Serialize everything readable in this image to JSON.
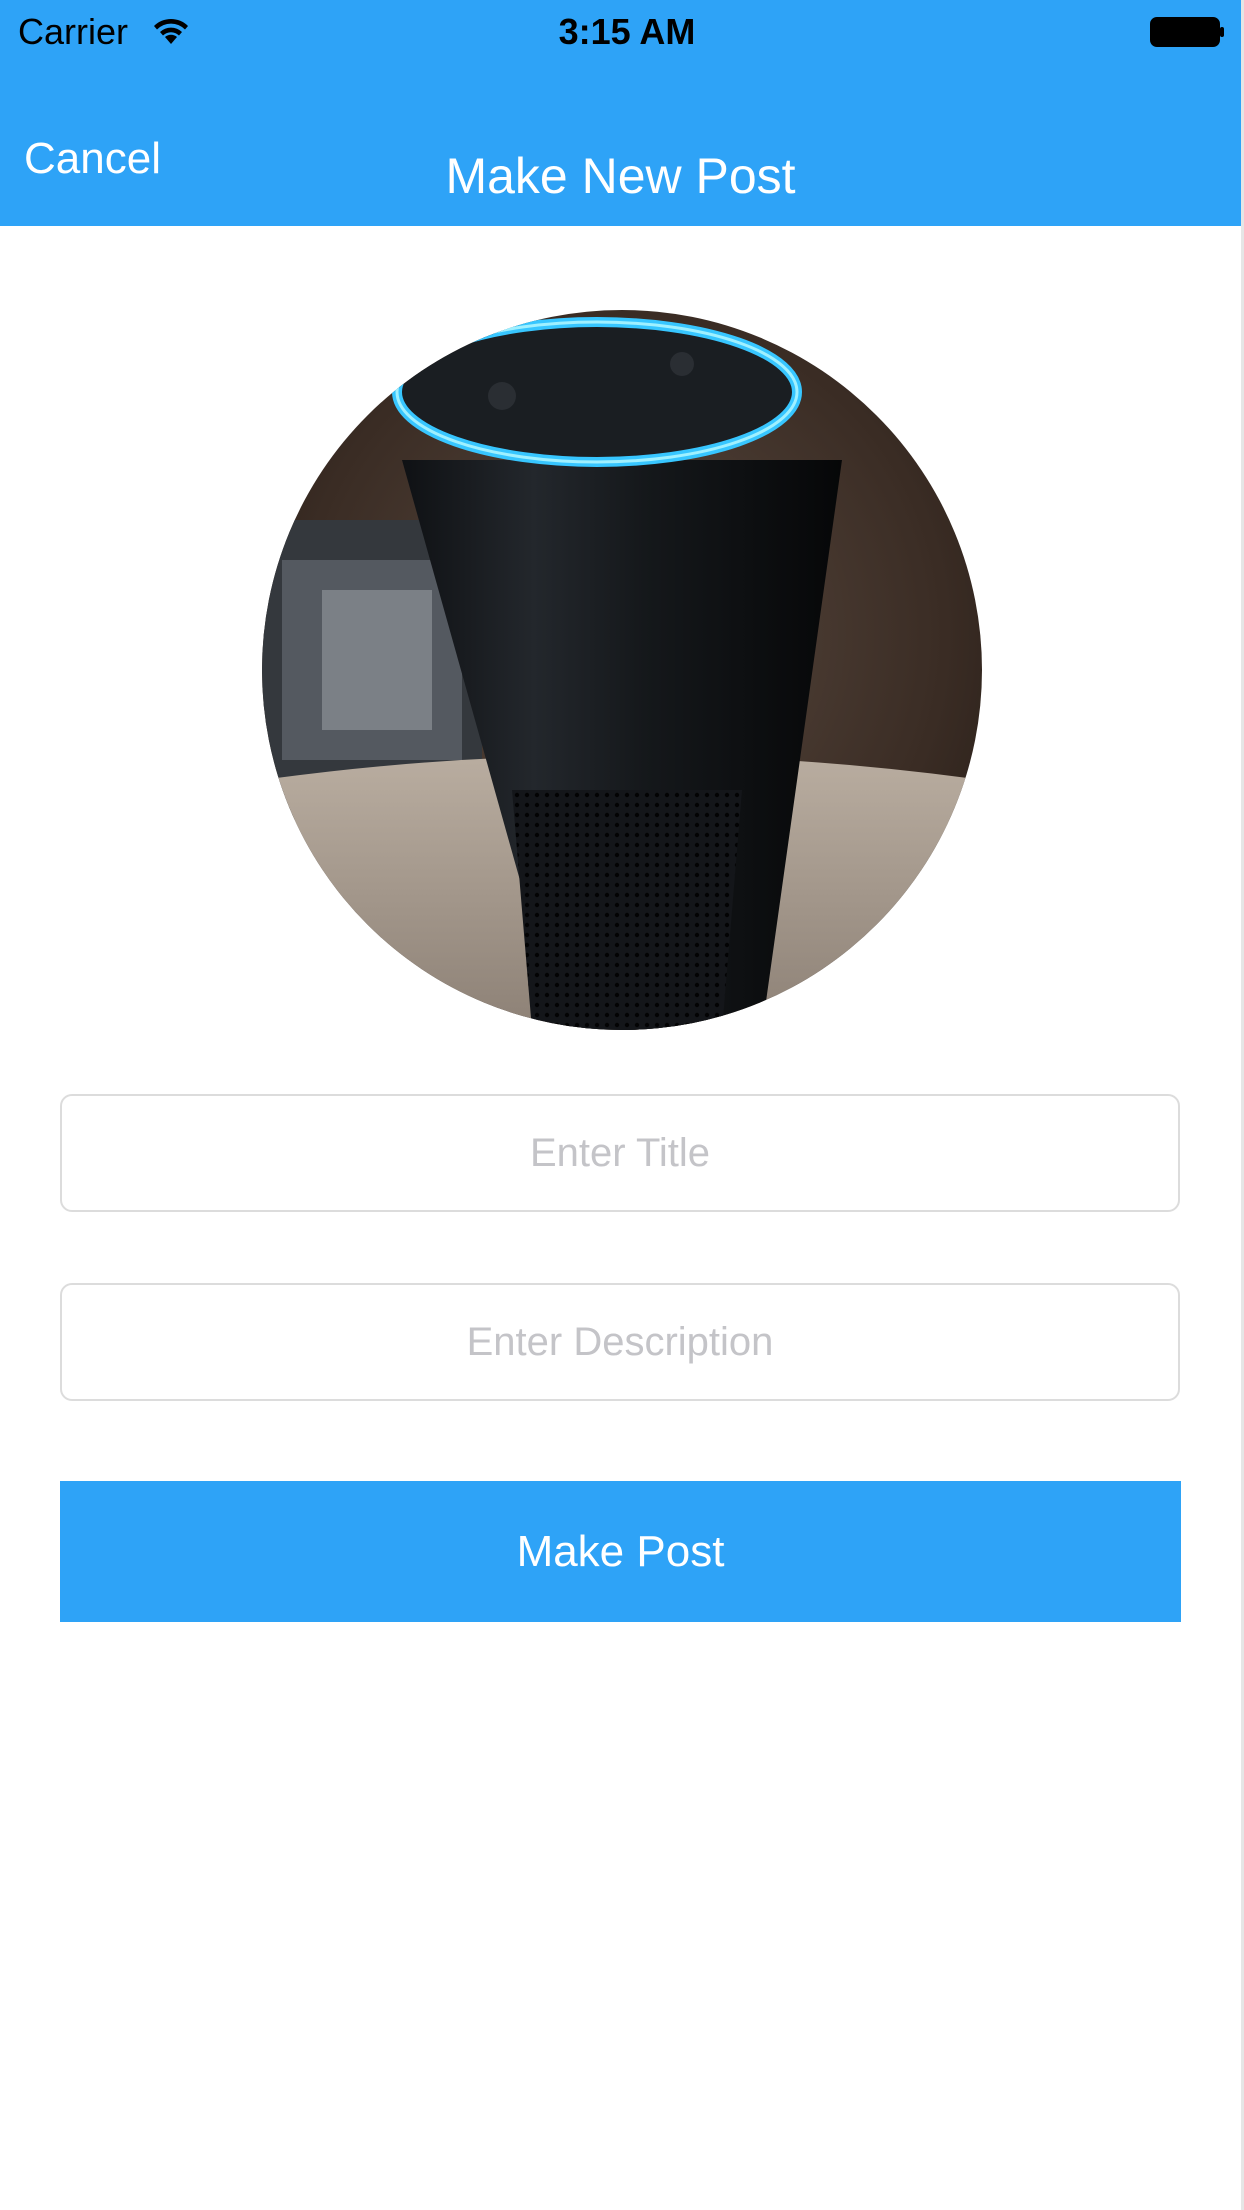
{
  "status_bar": {
    "carrier": "Carrier",
    "time": "3:15 AM",
    "wifi_icon": "wifi-icon",
    "battery_icon": "battery-icon"
  },
  "navbar": {
    "cancel_label": "Cancel",
    "title": "Make New Post",
    "background_color": "#2ea3f7"
  },
  "post_image": {
    "subject": "smart speaker photo"
  },
  "form": {
    "title_field": {
      "value": "",
      "placeholder": "Enter Title"
    },
    "description_field": {
      "value": "",
      "placeholder": "Enter Description"
    },
    "submit_label": "Make Post"
  },
  "colors": {
    "accent": "#2ea3f7",
    "placeholder": "#c4c4c8",
    "field_border": "#dcdcdc"
  }
}
